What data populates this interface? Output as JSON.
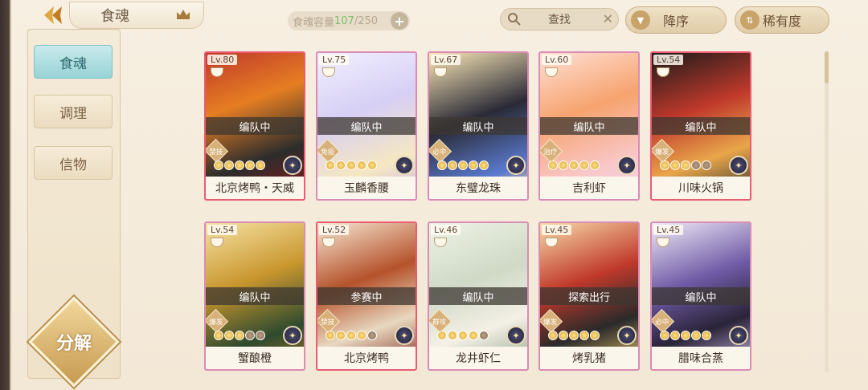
{
  "header": {
    "title": "食魂",
    "capacity_label": "食魂容量 ",
    "capacity_current": "107",
    "capacity_max": "/250",
    "search_label": "查找",
    "sort_label": "降序",
    "rarity_label": "稀有度"
  },
  "sidebar": {
    "items": [
      {
        "label": "食魂",
        "active": true
      },
      {
        "label": "调理",
        "active": false
      },
      {
        "label": "信物",
        "active": false
      }
    ],
    "decompose_label": "分解"
  },
  "cards": [
    {
      "level": "Lv.80",
      "status": "编队中",
      "role": "禁技",
      "name": "北京烤鸭・天威",
      "stars_lit": 5
    },
    {
      "level": "Lv.75",
      "status": "编队中",
      "role": "免疫",
      "name": "玉麟香腰",
      "stars_lit": 5
    },
    {
      "level": "Lv.67",
      "status": "编队中",
      "role": "必中",
      "name": "东璧龙珠",
      "stars_lit": 5
    },
    {
      "level": "Lv.60",
      "status": "编队中",
      "role": "治疗",
      "name": "吉利虾",
      "stars_lit": 5
    },
    {
      "level": "Lv.54",
      "status": "编队中",
      "role": "爆发",
      "name": "川味火锅",
      "stars_lit": 3
    },
    {
      "level": "Lv.54",
      "status": "编队中",
      "role": "爆发",
      "name": "蟹酿橙",
      "stars_lit": 3
    },
    {
      "level": "Lv.52",
      "status": "参赛中",
      "role": "禁技",
      "name": "北京烤鸭",
      "stars_lit": 4
    },
    {
      "level": "Lv.46",
      "status": "编队中",
      "role": "群攻",
      "name": "龙井虾仁",
      "stars_lit": 4
    },
    {
      "level": "Lv.45",
      "status": "探索出行",
      "role": "爆发",
      "name": "烤乳猪",
      "stars_lit": 5
    },
    {
      "level": "Lv.45",
      "status": "编队中",
      "role": "必中",
      "name": "腊味合蒸",
      "stars_lit": 5
    }
  ],
  "colors": {
    "accent_teal": "#98d3d6",
    "card_border_red": "#e95c73",
    "card_border_rainbow": "#d98cb4",
    "capacity_green": "#7cbf6a"
  }
}
